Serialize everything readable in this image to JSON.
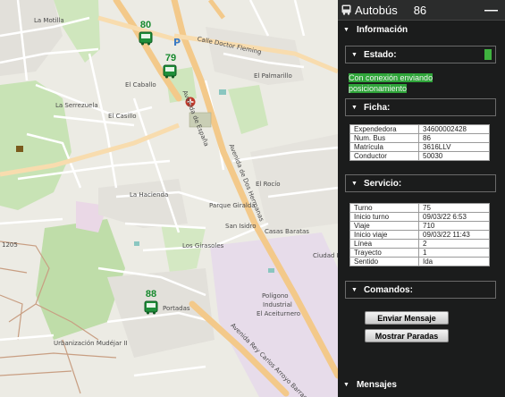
{
  "map": {
    "labels": {
      "la_motilla": "La Motilla",
      "el_caballo": "El Caballo",
      "la_serrezuela": "La Serrezuela",
      "el_casillo": "El Casillo",
      "el_palmarillo": "El Palmarillo",
      "la_hacienda": "La Hacienda",
      "parque_giralda": "Parque Giralda",
      "san_isidro": "San Isidro",
      "los_girasoles": "Los Girasoles",
      "casas_baratas": "Casas Baratas",
      "el_rocio": "El Rocío",
      "ciudad_r": "Ciudad R",
      "poligono": "Polígono",
      "industrial": "Industrial",
      "el_aceiturnero": "El Aceiturnero",
      "portadas": "Portadas",
      "calle_doctor_fleming": "Calle Doctor Fleming",
      "avenida_de_espana": "Avenida de España",
      "avenida_de_dos_hermanas": "Avenida de Dos Hermanas",
      "avenida_rey_carlos": "Avenida Rey Carlos Arroyo Barragán",
      "urb_mudejar": "Urbanización Mudéjar II",
      "num_1205": "1205"
    },
    "buses": [
      {
        "number": "80"
      },
      {
        "number": "79"
      },
      {
        "number": "88"
      }
    ],
    "parking_symbol": "P"
  },
  "panel": {
    "title_label": "Autobús",
    "bus_number": "86",
    "minimize_symbol": "—",
    "informacion_label": "Información",
    "estado": {
      "label": "Estado:",
      "status_line1": "Con conexión enviando",
      "status_line2": "posicionamiento",
      "led_color": "#3fb33f"
    },
    "ficha": {
      "label": "Ficha:",
      "rows": [
        {
          "k": "Expendedora",
          "v": "34600002428"
        },
        {
          "k": "Num. Bus",
          "v": "86"
        },
        {
          "k": "Matrícula",
          "v": "3616LLV"
        },
        {
          "k": "Conductor",
          "v": "50030"
        }
      ]
    },
    "servicio": {
      "label": "Servicio:",
      "rows": [
        {
          "k": "Turno",
          "v": "75"
        },
        {
          "k": "Inicio turno",
          "v": "09/03/22 6:53"
        },
        {
          "k": "Viaje",
          "v": "710"
        },
        {
          "k": "Inicio viaje",
          "v": "09/03/22 11:43"
        },
        {
          "k": "Línea",
          "v": "2"
        },
        {
          "k": "Trayecto",
          "v": "1"
        },
        {
          "k": "Sentido",
          "v": "Ida"
        }
      ]
    },
    "comandos": {
      "label": "Comandos:",
      "enviar_mensaje": "Enviar Mensaje",
      "mostrar_paradas": "Mostrar Paradas"
    },
    "mensajes_label": "Mensajes"
  }
}
